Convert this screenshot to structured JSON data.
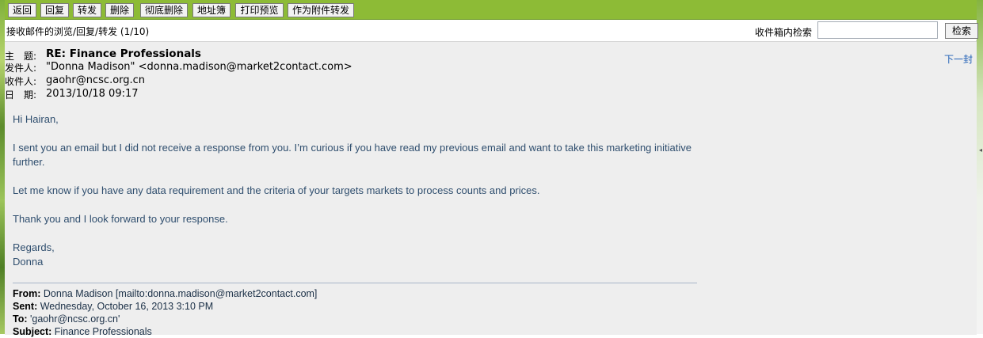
{
  "toolbar": {
    "buttons": [
      "返回",
      "回复",
      "转发",
      "删除",
      "彻底删除",
      "地址簿",
      "打印预览",
      "作为附件转发"
    ]
  },
  "infobar": {
    "breadcrumb": "接收邮件的浏览/回复/转发 (1/10)",
    "search_label": "收件箱内检索",
    "search_value": "",
    "search_button": "检索"
  },
  "header": {
    "subject_label": "主　题:",
    "subject": "RE: Finance Professionals",
    "from_label": "发件人:",
    "from": "\"Donna Madison\" <donna.madison@market2contact.com>",
    "to_label": "收件人:",
    "to": "gaohr@ncsc.org.cn",
    "date_label": "日　期:",
    "date": "2013/10/18 09:17",
    "next_link": "下一封"
  },
  "body": {
    "greeting": "Hi Hairan,",
    "p1": "I sent you an email but I did not receive a response from you. I’m curious if you have read my previous email and want to take this marketing initiative further.",
    "p2": "Let me know if you have any data requirement and the criteria of your targets markets to process counts and prices.",
    "p3": "Thank you and I look forward to your response.",
    "regards": "Regards,",
    "signature": "Donna"
  },
  "forwarded": {
    "from_label": "From:",
    "from": "Donna Madison [mailto:donna.madison@market2contact.com]",
    "sent_label": "Sent:",
    "sent": "Wednesday, October 16, 2013 3:10 PM",
    "to_label": "To:",
    "to": "'gaohr@ncsc.org.cn'",
    "subject_label": "Subject:",
    "subject": "Finance Professionals"
  },
  "colors": {
    "toolbar_bg": "#8dbb36",
    "body_text": "#2f4e6e",
    "link": "#1f5fb6",
    "pane_bg": "#eeeeee"
  }
}
